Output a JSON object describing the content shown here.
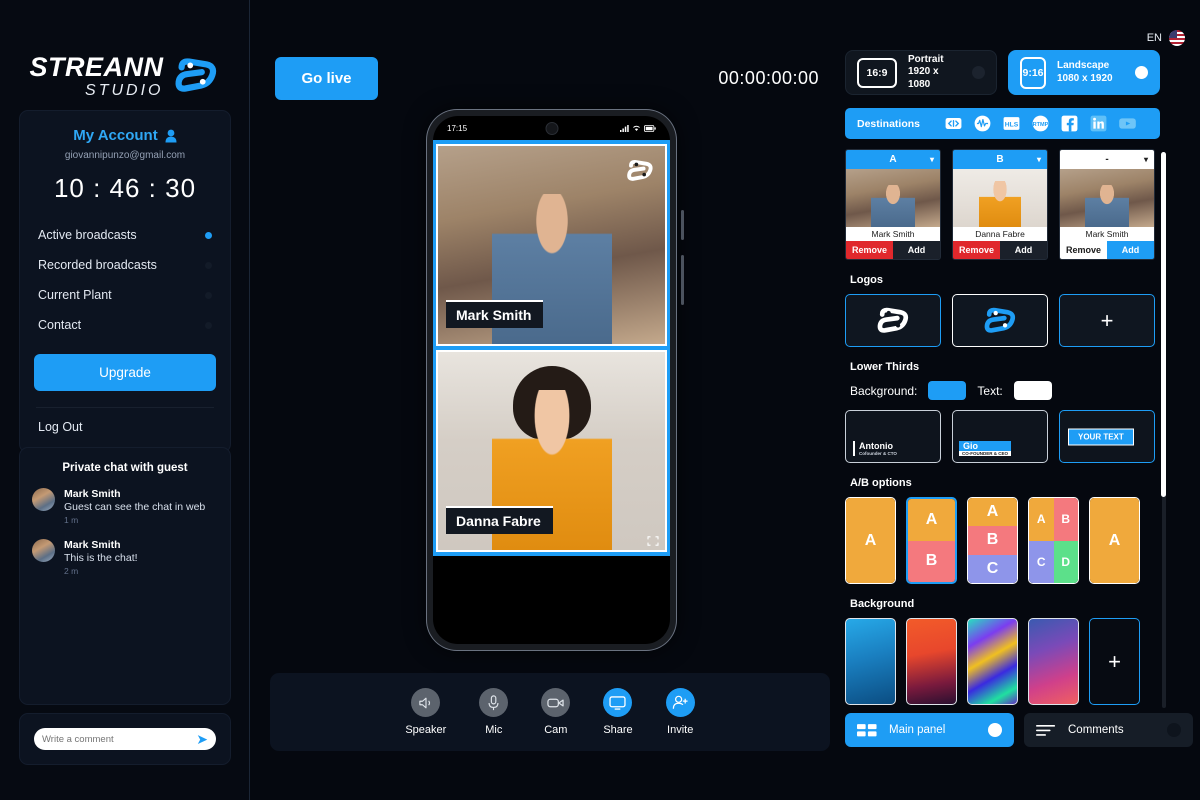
{
  "brand": {
    "name": "STREANN",
    "sub": "STUDIO",
    "accent": "#1e9df5"
  },
  "language": {
    "code": "EN",
    "flag": "us-flag-icon"
  },
  "account": {
    "title": "My Account",
    "email": "giovannipunzo@gmail.com",
    "timer": "10 : 46 : 30",
    "nav": [
      {
        "label": "Active broadcasts",
        "active": true
      },
      {
        "label": "Recorded broadcasts",
        "active": false
      },
      {
        "label": "Current Plant",
        "active": false
      },
      {
        "label": "Contact",
        "active": false
      }
    ],
    "upgrade_label": "Upgrade",
    "logout_label": "Log Out"
  },
  "chat": {
    "title": "Private chat with guest",
    "messages": [
      {
        "name": "Mark Smith",
        "text": "Guest can see the chat in web",
        "time": "1 m"
      },
      {
        "name": "Mark Smith",
        "text": "This is the chat!",
        "time": "2 m"
      }
    ],
    "input_placeholder": "Write a comment",
    "input_value": ""
  },
  "toolbar": {
    "golive_label": "Go live",
    "timecode": "00:00:00:00"
  },
  "phone": {
    "status_time": "17:15",
    "tiles": [
      {
        "name": "Mark Smith"
      },
      {
        "name": "Danna Fabre"
      }
    ]
  },
  "controls": [
    {
      "label": "Speaker",
      "icon": "speaker-icon",
      "active": false
    },
    {
      "label": "Mic",
      "icon": "mic-icon",
      "active": false
    },
    {
      "label": "Cam",
      "icon": "cam-icon",
      "active": false
    },
    {
      "label": "Share",
      "icon": "screen-share-icon",
      "active": true
    },
    {
      "label": "Invite",
      "icon": "invite-user-icon",
      "active": true
    }
  ],
  "ratios": [
    {
      "badge": "16:9",
      "name": "Portrait",
      "dim": "1920 x 1080",
      "selected": false
    },
    {
      "badge": "9:16",
      "name": "Landscape",
      "dim": "1080 x 1920",
      "selected": true
    }
  ],
  "destinations": {
    "label": "Destinations",
    "icons": [
      "embed-code-icon",
      "audio-wave-icon",
      "hls-icon",
      "rtmp-icon",
      "facebook-icon",
      "linkedin-icon",
      "youtube-icon"
    ]
  },
  "sources": [
    {
      "slot": "A",
      "name": "Mark Smith",
      "remove": "Remove",
      "add": "Add",
      "remove_style": "red",
      "add_style": "dark",
      "head_style": "a"
    },
    {
      "slot": "B",
      "name": "Danna Fabre",
      "remove": "Remove",
      "add": "Add",
      "remove_style": "red",
      "add_style": "dark",
      "head_style": "b"
    },
    {
      "slot": "-",
      "name": "Mark Smith",
      "remove": "Remove",
      "add": "Add",
      "remove_style": "white",
      "add_style": "blue",
      "head_style": "none"
    }
  ],
  "logos": {
    "title": "Logos",
    "items": [
      "logo-white-icon",
      "logo-blue-icon"
    ],
    "add_label": "+"
  },
  "lower_thirds": {
    "title": "Lower Thirds",
    "background_label": "Background:",
    "background_color": "#1e9df5",
    "text_label": "Text:",
    "text_color": "#ffffff",
    "templates": [
      {
        "name": "Antonio",
        "role": "Cofounder & CTO"
      },
      {
        "name": "Gio",
        "role": "CO-FOUNDER & CEO"
      },
      {
        "name": "YOUR TEXT",
        "role": ""
      }
    ]
  },
  "ab_options": {
    "title": "A/B options",
    "layouts": [
      {
        "cells": [
          "A"
        ],
        "colors": [
          "c-orange"
        ],
        "rows": 1,
        "cols": 1,
        "selected": false
      },
      {
        "cells": [
          "A",
          "B"
        ],
        "colors": [
          "c-orange",
          "c-red"
        ],
        "rows": 2,
        "cols": 1,
        "selected": true
      },
      {
        "cells": [
          "A",
          "B",
          "C"
        ],
        "colors": [
          "c-orange",
          "c-red",
          "c-blue"
        ],
        "rows": 3,
        "cols": 1,
        "selected": false
      },
      {
        "cells": [
          "A",
          "B",
          "C",
          "D"
        ],
        "colors": [
          "c-orange",
          "c-red",
          "c-blue",
          "c-green"
        ],
        "rows": 2,
        "cols": 2,
        "selected": false
      },
      {
        "cells": [
          "A"
        ],
        "colors": [
          "c-orange"
        ],
        "rows": 1,
        "cols": 1,
        "selected": false
      }
    ]
  },
  "background": {
    "title": "Background",
    "swatches": [
      "bg1",
      "bg2",
      "bg3",
      "bg4"
    ],
    "add_label": "+"
  },
  "bottom_tabs": [
    {
      "label": "Main panel",
      "icon": "grid-panel-icon",
      "active": true
    },
    {
      "label": "Comments",
      "icon": "comments-lines-icon",
      "active": false
    }
  ]
}
